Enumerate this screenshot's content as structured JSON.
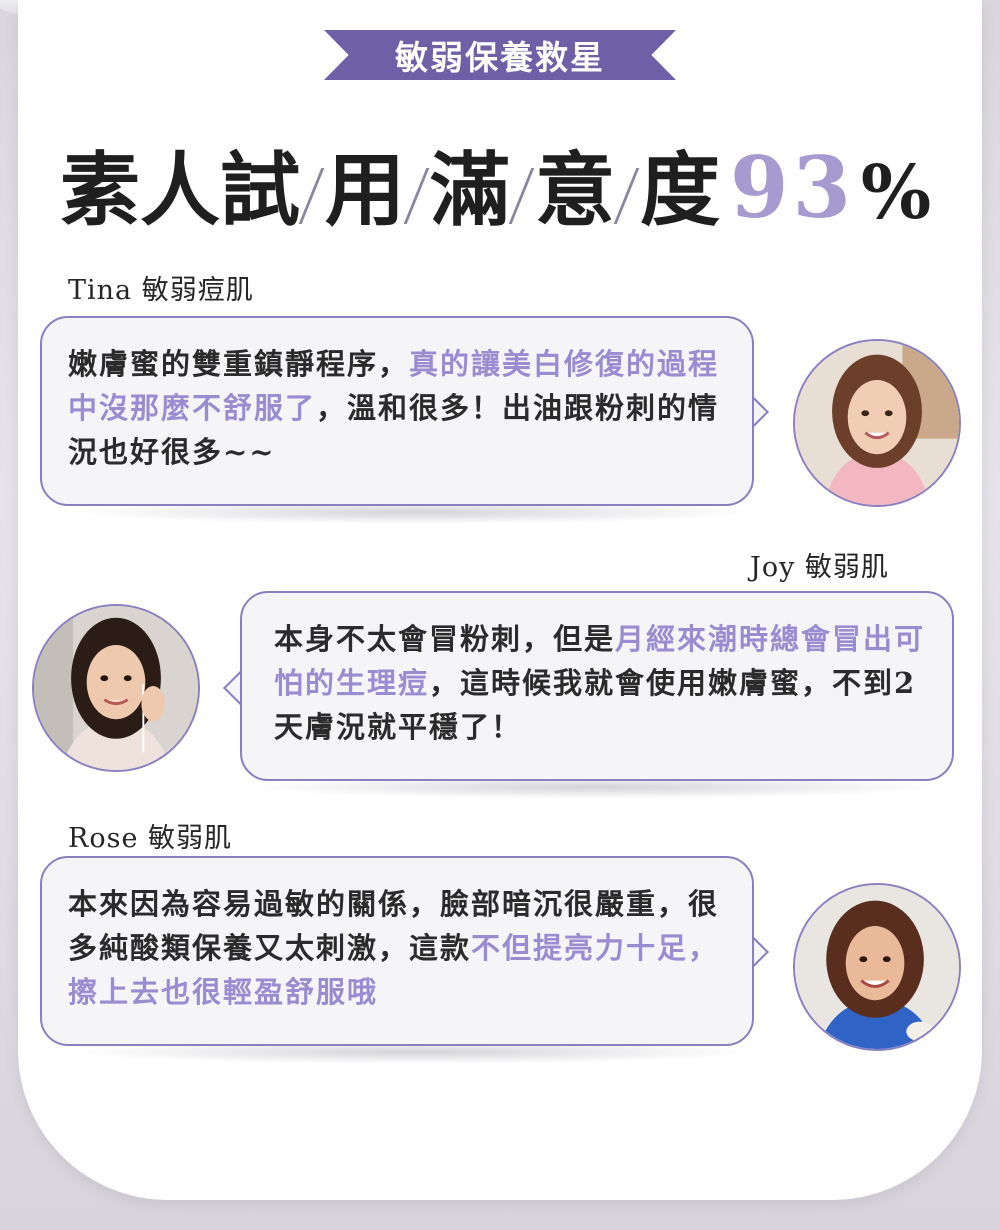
{
  "banner": {
    "label": "敏弱保養救星"
  },
  "headline": {
    "chars": [
      "素人試",
      "用",
      "滿",
      "意",
      "度"
    ],
    "number": "93",
    "percent": "%"
  },
  "reviews": [
    {
      "name": "Tina 敏弱痘肌",
      "text_normal_1": "嫩膚蜜的雙重鎮靜程序，",
      "text_highlight": "真的讓美白修復的過程中沒那麼不舒服了",
      "text_normal_2": "，溫和很多！出油跟粉刺的情況也好很多~~",
      "avatar_icon": "woman-pink-sweater-avatar"
    },
    {
      "name": "Joy 敏弱肌",
      "text_normal_1": "本身不太會冒粉刺，但是",
      "text_highlight": "月經來潮時總會冒出可怕的生理痘",
      "text_normal_2": "，這時候我就會使用嫩膚蜜，不到2天膚況就平穩了！",
      "avatar_icon": "woman-earphones-avatar"
    },
    {
      "name": "Rose 敏弱肌",
      "text_normal_1": "本來因為容易過敏的關係，臉部暗沉很嚴重，很多純酸類保養又太刺激，這款",
      "text_highlight": "不但提亮力十足，擦上去也很輕盈舒服哦",
      "text_normal_2": "",
      "avatar_icon": "woman-blue-shirt-avatar"
    }
  ],
  "colors": {
    "accent": "#6e5fa6",
    "highlight": "#9a8cd0",
    "number": "#a79ad0",
    "border": "#8a7fbf"
  }
}
